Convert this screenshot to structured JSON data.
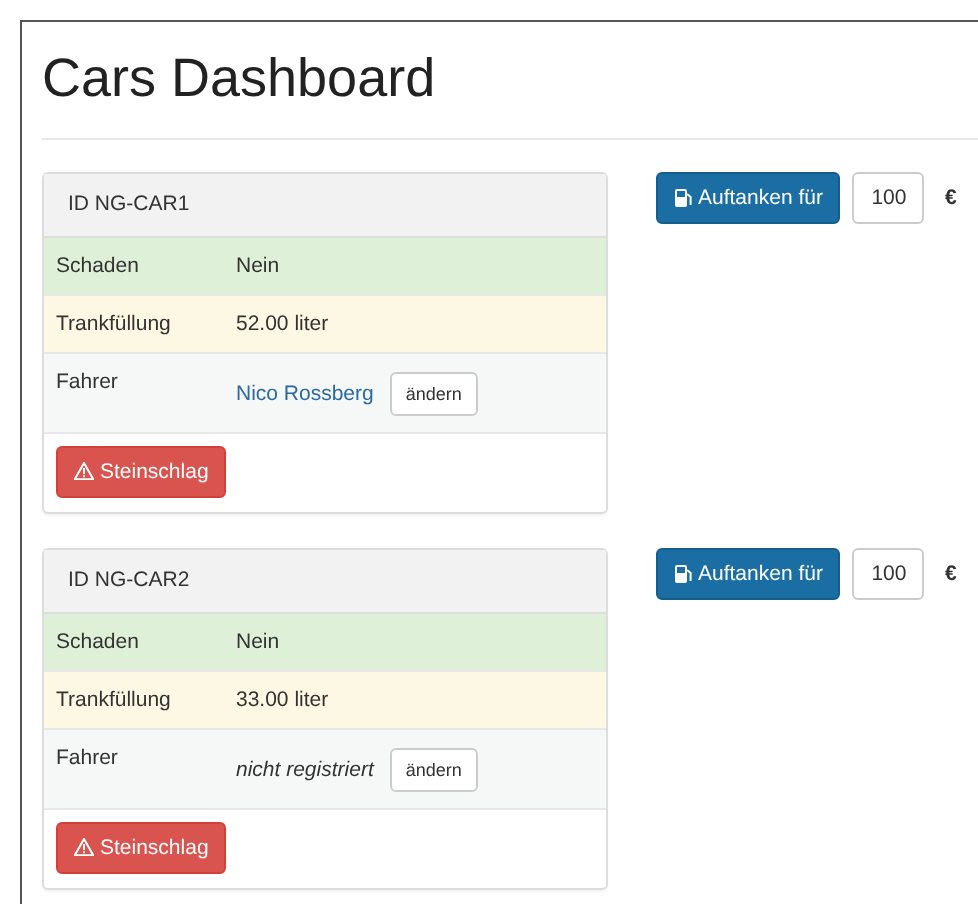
{
  "title": "Cars Dashboard",
  "cars": [
    {
      "id": "ID NG-CAR1",
      "rows": [
        {
          "kind": "success",
          "label": "Schaden",
          "value": "Nein"
        },
        {
          "kind": "warning",
          "label": "Trankfüllung",
          "value": "52.00 liter"
        }
      ],
      "driver": {
        "label": "Fahrer",
        "name": "Nico Rossberg",
        "registered": true,
        "button": "ändern"
      },
      "damage_button": "Steinschlag",
      "refuel": {
        "button": "Auftanken für",
        "amount": "100",
        "currency": "€"
      }
    },
    {
      "id": "ID NG-CAR2",
      "rows": [
        {
          "kind": "success",
          "label": "Schaden",
          "value": "Nein"
        },
        {
          "kind": "warning",
          "label": "Trankfüllung",
          "value": "33.00 liter"
        }
      ],
      "driver": {
        "label": "Fahrer",
        "name": "nicht registriert",
        "registered": false,
        "button": "ändern"
      },
      "damage_button": "Steinschlag",
      "refuel": {
        "button": "Auftanken für",
        "amount": "100",
        "currency": "€"
      }
    }
  ]
}
